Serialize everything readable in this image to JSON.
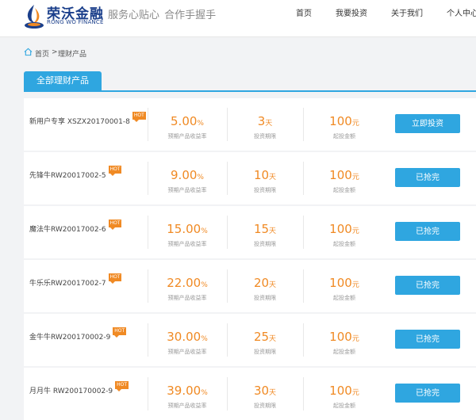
{
  "header": {
    "logo_cn": "荣沃金融",
    "logo_en": "RONG WO FINANCE",
    "slogan": "服务心贴心  合作手握手",
    "nav": [
      "首页",
      "我要投资",
      "关于我们",
      "个人中心"
    ]
  },
  "breadcrumb": {
    "home": "首页",
    "separator": ">",
    "current": "理财产品"
  },
  "tab": {
    "label": "全部理财产品"
  },
  "labels": {
    "rate": "预期产品收益率",
    "term": "投资期限",
    "min": "起投金额"
  },
  "hot_badge": "HOT",
  "products": [
    {
      "name": "新用户专享 XSZX20170001-8",
      "rate": "5.00",
      "rate_unit": "%",
      "term": "3",
      "term_unit": "天",
      "min": "100",
      "min_unit": "元",
      "button": "立即投资"
    },
    {
      "name": "先锋牛RW20017002-5",
      "rate": "9.00",
      "rate_unit": "%",
      "term": "10",
      "term_unit": "天",
      "min": "100",
      "min_unit": "元",
      "button": "已抢完"
    },
    {
      "name": "魔法牛RW20017002-6",
      "rate": "15.00",
      "rate_unit": "%",
      "term": "15",
      "term_unit": "天",
      "min": "100",
      "min_unit": "元",
      "button": "已抢完"
    },
    {
      "name": "牛乐乐RW20017002-7",
      "rate": "22.00",
      "rate_unit": "%",
      "term": "20",
      "term_unit": "天",
      "min": "100",
      "min_unit": "元",
      "button": "已抢完"
    },
    {
      "name": "金牛牛RW200170002-9",
      "rate": "30.00",
      "rate_unit": "%",
      "term": "25",
      "term_unit": "天",
      "min": "100",
      "min_unit": "元",
      "button": "已抢完"
    },
    {
      "name": "月月牛 RW200170002-9",
      "rate": "39.00",
      "rate_unit": "%",
      "term": "30",
      "term_unit": "天",
      "min": "100",
      "min_unit": "元",
      "button": "已抢完"
    }
  ],
  "colors": {
    "accent": "#2fa6e0",
    "highlight": "#f08a24",
    "brand": "#1b3f8b"
  }
}
